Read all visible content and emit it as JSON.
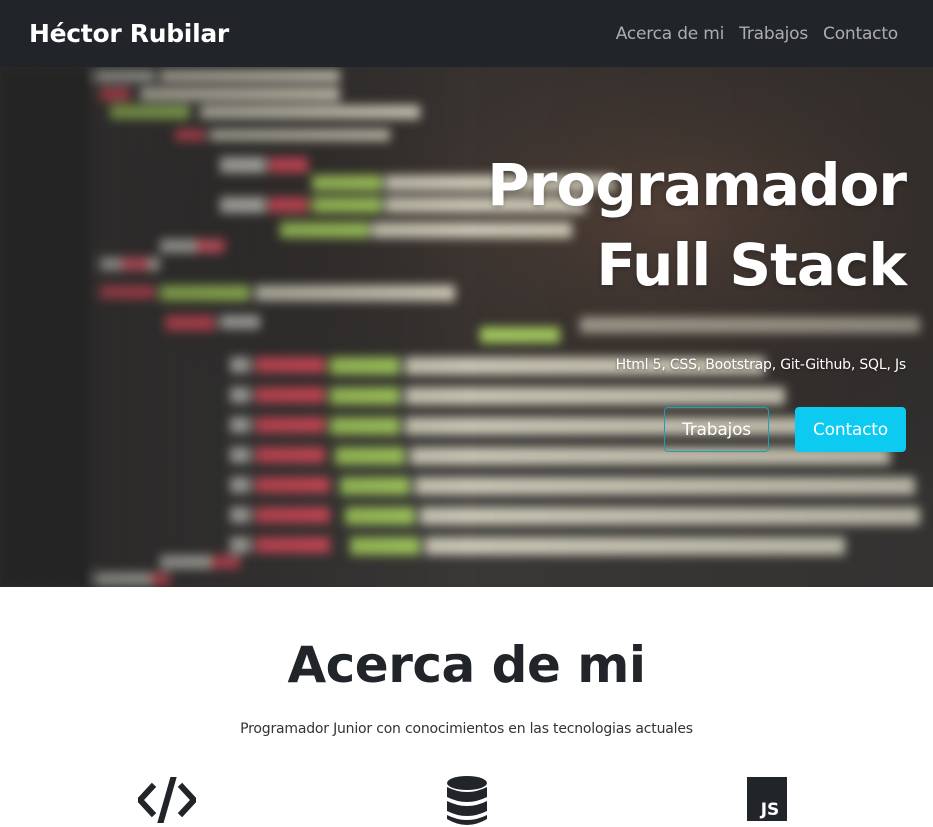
{
  "navbar": {
    "brand": "Héctor Rubilar",
    "links": [
      "Acerca de mi",
      "Trabajos",
      "Contacto"
    ]
  },
  "hero": {
    "title_line1": "Programador",
    "title_line2": "Full Stack",
    "subtitle": "Html 5, CSS, Bootstrap, Git-Github, SQL, Js",
    "buttons": {
      "works": "Trabajos",
      "contact": "Contacto"
    }
  },
  "about": {
    "title": "Acerca de mi",
    "text": "Programador Junior con conocimientos en las tecnologias actuales",
    "icons": [
      "code-icon",
      "database-icon",
      "js-icon"
    ]
  },
  "colors": {
    "navbar_bg": "#212529",
    "accent": "#0dcaf0",
    "outline_border": "#17a2b8"
  }
}
